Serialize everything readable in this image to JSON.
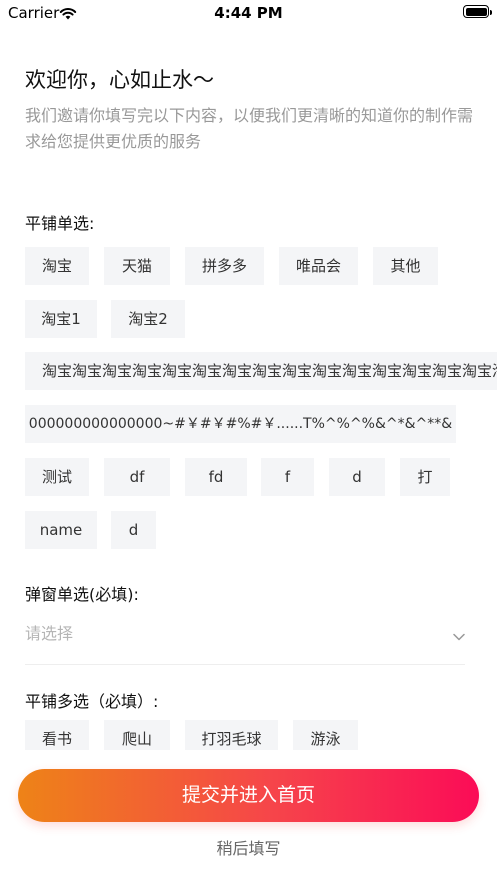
{
  "status_bar": {
    "carrier": "Carrier",
    "time": "4:44 PM"
  },
  "header": {
    "title": "欢迎你，心如止水～",
    "subtitle": "我们邀请你填写完以下内容，以便我们更清晰的知道你的制作需求给您提供更优质的服务"
  },
  "tile_single": {
    "label": "平铺单选:",
    "options": [
      "淘宝",
      "天猫",
      "拼多多",
      "唯品会",
      "其他",
      "淘宝1",
      "淘宝2",
      "淘宝淘宝淘宝淘宝淘宝淘宝淘宝淘宝淘宝淘宝淘宝淘宝淘宝淘宝淘宝淘宝",
      "000000000000000~#￥#￥#%#￥......T%^%^%&^*&^**&",
      "测试",
      "df",
      "fd",
      "f",
      "d",
      "打",
      "name",
      "d"
    ]
  },
  "popup_single": {
    "label": "弹窗单选(必填):",
    "placeholder": "请选择"
  },
  "tile_multi": {
    "label": "平铺多选（必填）:",
    "options": [
      "看书",
      "爬山",
      "打羽毛球",
      "游泳"
    ]
  },
  "actions": {
    "submit": "提交并进入首页",
    "later": "稍后填写"
  },
  "colors": {
    "gradient_start": "#ee8317",
    "gradient_end": "#fb0c57",
    "chip_bg": "#f4f5f7"
  }
}
